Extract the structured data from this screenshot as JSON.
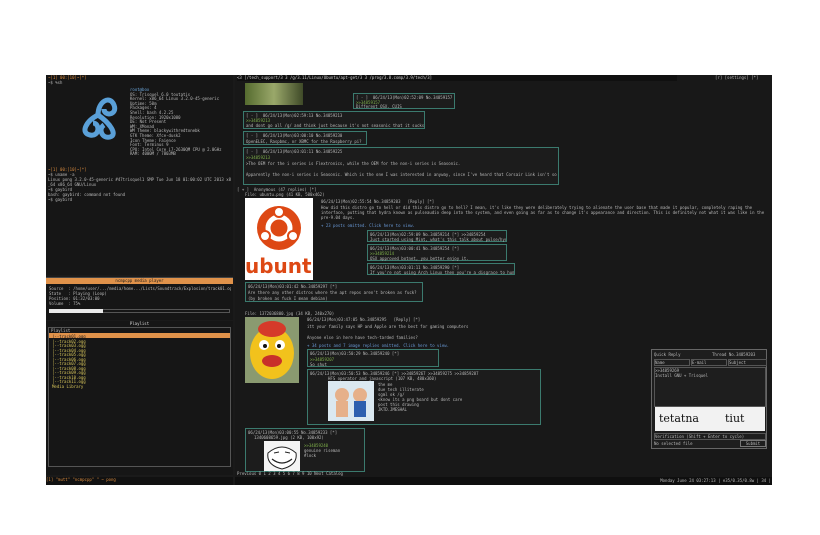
{
  "terminal": {
    "title_bar": "~[1] 00:[10]~[*]",
    "prompt1": "~$ %sh",
    "sysinfo": [
      "root@box",
      "OS: Trisquel 6.0 toutatis",
      "Kernel: x86_64 Linux 3.2.0-45-generic",
      "Uptime: 50m",
      "Packages: 4",
      "Shell: bash 4.2.25",
      "Resolution: 1920x1080",
      "DE: Not Present",
      "WM: XMonad",
      "WM Theme: blackywithredtonebk",
      "GTK Theme: Xfce-dusk2",
      "Icon Theme: Faience",
      "Font: Terminus 9",
      "CPU: Intel Core i7-2630QM CPU @ 2.0GHz",
      "RAM: 4000M / 7803MB"
    ],
    "lines": [
      "~[1] 00:[10]~[*]",
      "~$ uname -a",
      "Linux pong 3.2.0-45-generic #47trisquel1 SMP Tue Jun 18 01:00:02 UTC 2013 x86_64 x86",
      "_64 x86_64 GNU/Linux",
      "~$ gaybird",
      "bash: gaybird: command not found",
      "~$ gaybird"
    ]
  },
  "player": {
    "header": "ncmpcpp media player",
    "source": "Source  : /home/user/.../media/home.../Lists/Soundtrack/Explosion/track01.ogg",
    "state": "State   : Playing (Loop)",
    "position": "Position: 01:32/03:00",
    "volume": "Volume  : 75%",
    "progress": 0.3
  },
  "playlist": {
    "header": "Playlist",
    "title": "Playlist",
    "items": [
      "|--track01.ogg",
      "|--track02.ogg",
      "|--track03.ogg",
      "|--track04.ogg",
      "|--track05.ogg",
      "|--track06.ogg",
      "|--track07.ogg",
      "|--track08.ogg",
      "|--track09.ogg",
      "|--track10.ogg",
      "|--track11.ogg"
    ],
    "footer": "Media Library"
  },
  "left_status": "[1] \"mutt\" \"ncmpcpp\" \" ~ pong",
  "browser": {
    "tab": "<3 [/tech_support/3 3 /g/3.11/Linux/Ubuntu/apt-get/3 3 /prog/3.8.comp/3.9/tech/3]",
    "tab_right": "[r] [settings] [*]",
    "posts": [
      {
        "meta": "[ - ]  06/24/13(Mon)02:52:09 No.34859157",
        "text": ">>34859157  ",
        "extra": "Different OSX. CUIS"
      },
      {
        "meta": "[ - ]  06/24/13(Mon)02:59:13 No.34859213",
        "text": ">>34859213",
        "extra": "and dont go all /g/ and think just because it's not seasonic that it sucks"
      },
      {
        "meta": "[ - ]  06/24/13(Mon)03:00:10 No.34859230",
        "text": "OpenELEC, Raspbmc, or XBMC for the Raspberry pi?",
        "extra": ""
      },
      {
        "meta": "[ - ]  06/24/13(Mon)03:01:11 No.34859225",
        "text": ">>34859213",
        "extra": ">The OEM for the i series is Flextronics, while the OEM for the non-i series is Seasonic."
      },
      {
        "meta": "",
        "text": "Apparently the non-i series is Seasonic. Which is the one I was interested in anyway, since I've heard that Corsair Link isn't so great.",
        "extra": ""
      }
    ],
    "thread1": {
      "head": "[ + ]  Anonymous (47 replies) [*]",
      "file": "File: ubuntu.png (41 KB, 500x462)",
      "meta": "06/24/13(Mon)02:55:54 No.34859203   [Reply] [*]",
      "body": "How did this distro go to hell or did this distro go to hell? I mean, it's like they were deliberately trying to alienate the user base that made it popular, completely raping the interface, putting that hydra known as pulseaudio deep into the system, and even going as far as to change it's appearance and direction. This is definitely not what it was like in the pre-9.04 days.",
      "omitted": "+ 23 posts omitted. Click here to view.",
      "logo_word": "ubuntu"
    },
    "replies1": [
      {
        "meta": "06/24/13(Mon)02:59:09 No.34859214 [*] >>34859254",
        "text": "Just started using Mint, what's this talk about pulse/hydra?"
      },
      {
        "meta": "06/24/13(Mon)03:00:41 No.34859254 [*]",
        "text": ">>34859214  ",
        "extra": "OSX approved botnet, you better enjoy it."
      },
      {
        "meta": "06/24/13(Mon)03:01:11 No.34859290 [*]",
        "text": "If you're not using Arch Linux then you're a disgrace to humanity."
      }
    ],
    "q1": {
      "meta": "06/24/13(Mon)03:01:42 No.34859297 [*]",
      "text": "Are there any other distros where the apt repos aren't broken as fuck?",
      "extra": "(by broken as fuck I mean debian)"
    },
    "thread2": {
      "file": "File: 1372036800.jpg (34 KB, 240x270)",
      "meta": "06/24/13(Mon)03:47:05 No.34859295   [Reply] [*]",
      "body": "itt your family says HP and Apple are the best for gaming computers",
      "line2": "Anyone else in here have tech-tarded families?",
      "omitted": "+ 34 posts and 7 image replies omitted. Click here to view."
    },
    "replies2": [
      {
        "meta": "06/24/13(Mon)03:50:29 No.34859240 [*]",
        "text": ">>34859207",
        "extra": "So shut"
      },
      {
        "meta": "06/24/13(Mon)03:50:53 No.34859246 [*] >>34859267 >>34859275 >>34859287",
        "text": "HFS operator and javascript (107 KB, 480x360)",
        "lines": [
          "the me",
          "due tech illiterate",
          "sgml ok /g/",
          "<know its a png board but dont care",
          "post this drawing",
          "JKTD.JMESHAL"
        ]
      }
    ],
    "thread3": {
      "meta": "06/24/13(Mon)03:00:55 No.34859233 [*]",
      "file": "1340608659.jpg (2 KB, 100x92)",
      "text": ">>34859240",
      "extra": "genuine riseman",
      "extra2": "#lock"
    },
    "quick_reply": {
      "title": "Quick Reply",
      "thread": "Thread No.34859203",
      "name": "Name",
      "email": "E-mail",
      "subject": "Subject",
      "body": ">>34859269\nInstall GNU + Trisquel",
      "captcha_a": "tetatna",
      "captcha_b": "tiut",
      "verification": "Verification (Shift + Enter to cycle)",
      "file": "No selected file",
      "submit": "Submit"
    },
    "nav": "Previous 0 1 2 3 4 5 6 7 8 9 10 Next Catalog",
    "status_right": "Monday June 24 03:27:13 | e35/0.35/0.8w | 34 |"
  },
  "colors": {
    "accent": "#e0924a",
    "quote": "#7fb04a",
    "border": "#3b7a6e",
    "ubuntu": "#dd4814"
  },
  "icons": [
    "triskelion-logo",
    "ubuntu-logo",
    "cartoon-avatar",
    "comic-thumbnail",
    "trollface-thumbnail"
  ]
}
